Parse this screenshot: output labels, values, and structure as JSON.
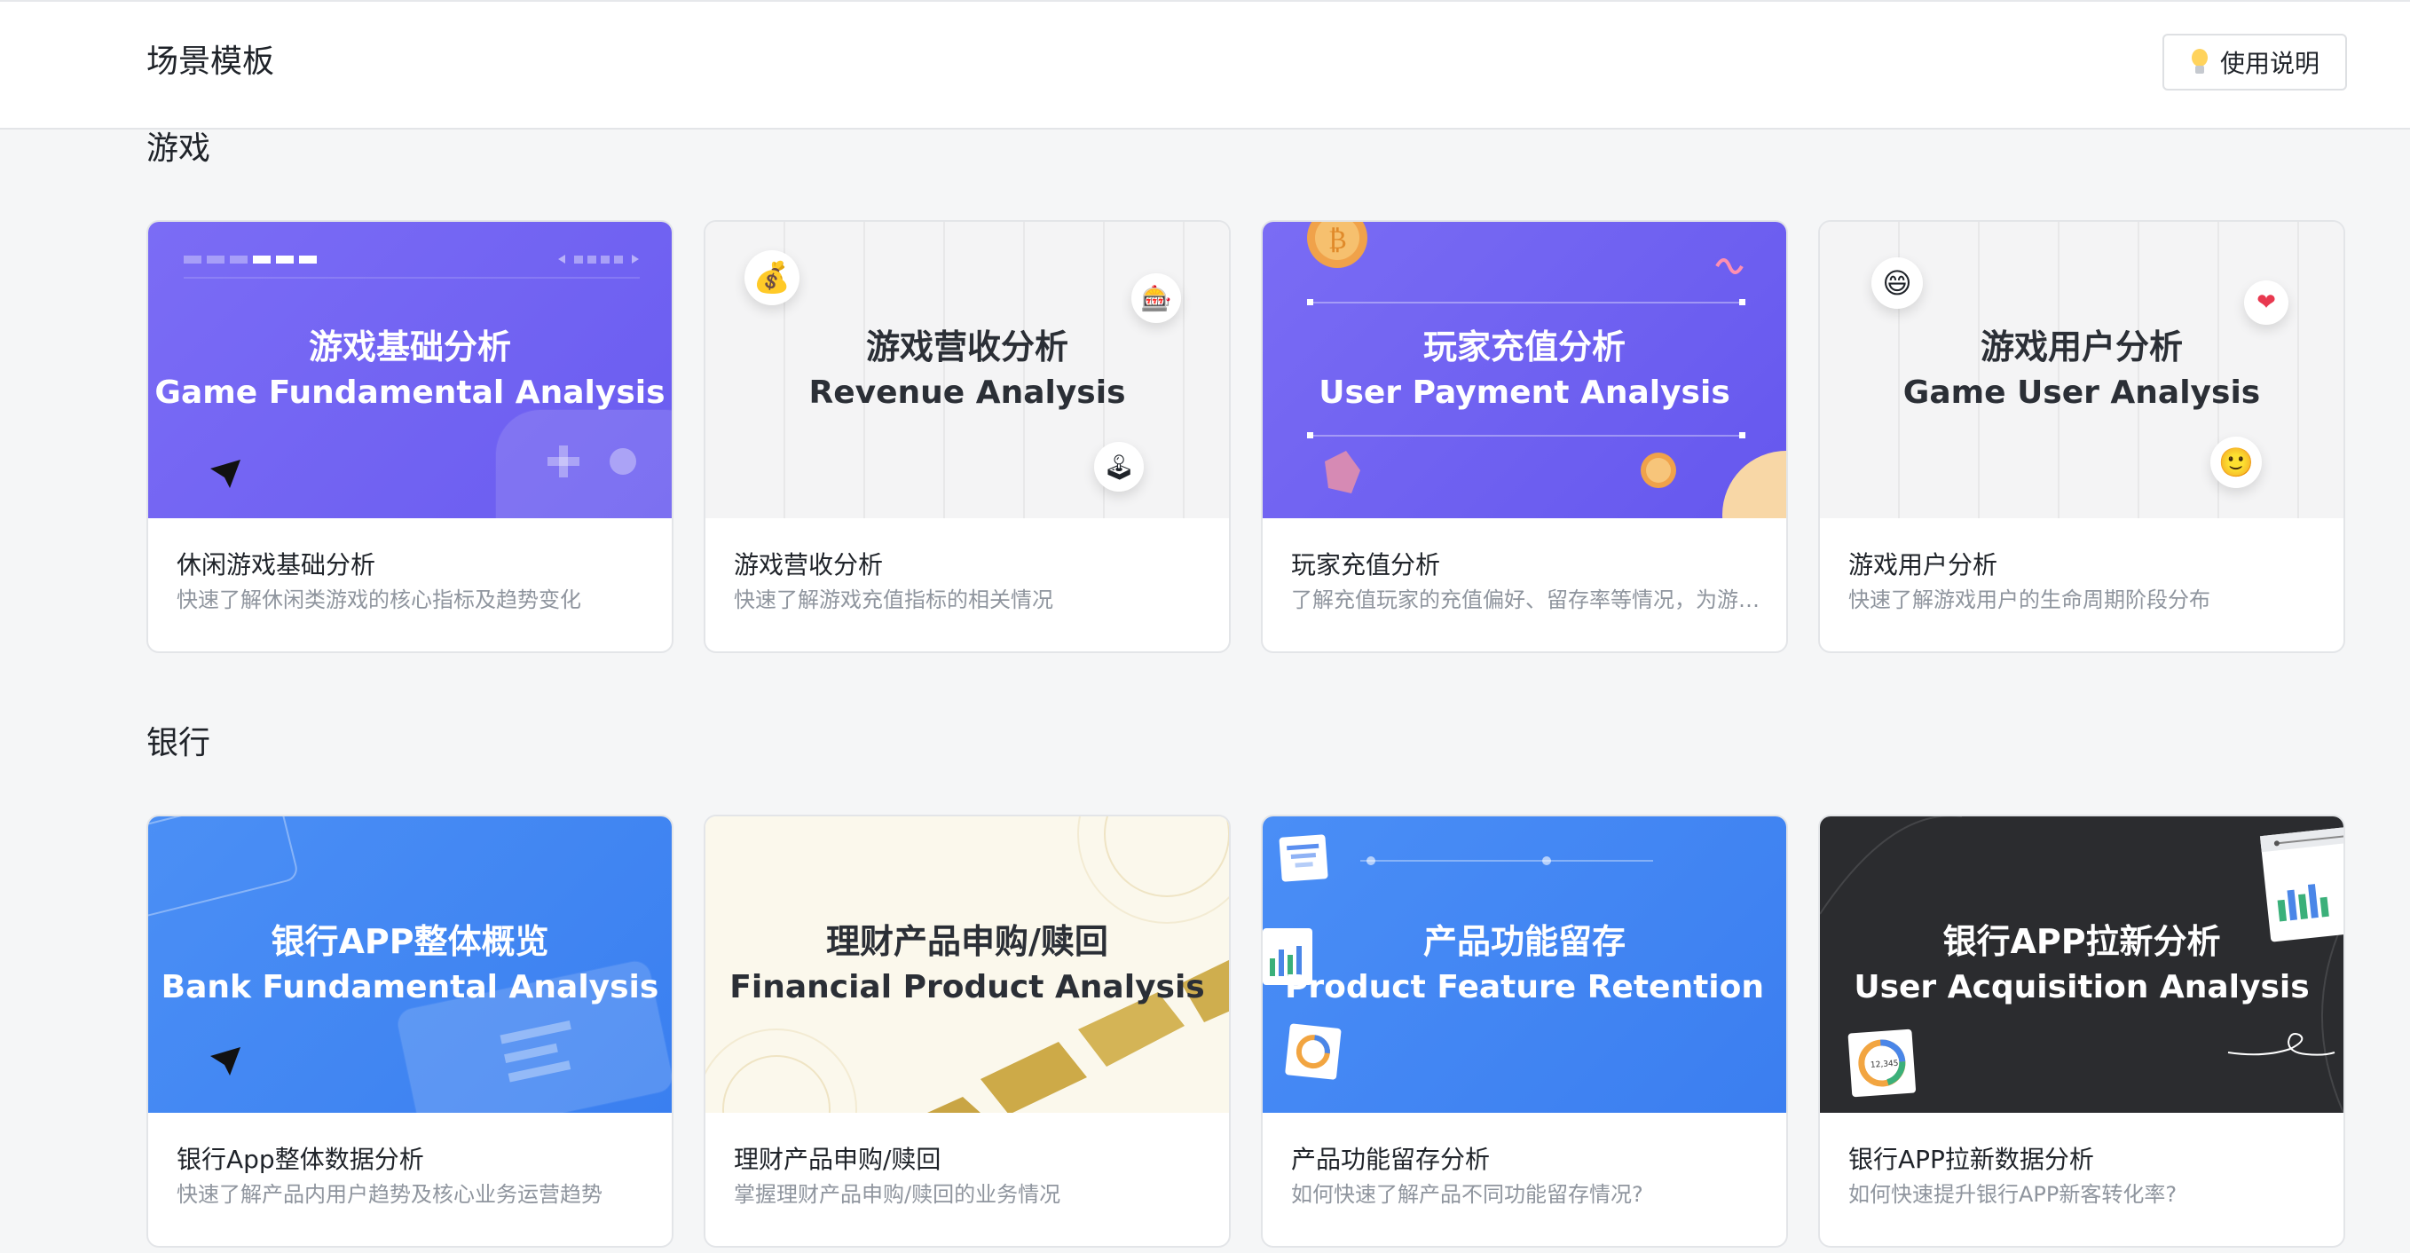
{
  "header": {
    "title": "场景模板",
    "help_label": "使用说明"
  },
  "sections": [
    {
      "title": "游戏",
      "cards": [
        {
          "banner_zh": "游戏基础分析",
          "banner_en": "Game Fundamental Analysis",
          "title": "休闲游戏基础分析",
          "desc": "快速了解休闲类游戏的核心指标及趋势变化"
        },
        {
          "banner_zh": "游戏营收分析",
          "banner_en": "Revenue Analysis",
          "title": "游戏营收分析",
          "desc": "快速了解游戏充值指标的相关情况"
        },
        {
          "banner_zh": "玩家充值分析",
          "banner_en": "User Payment Analysis",
          "title": "玩家充值分析",
          "desc": "了解充值玩家的充值偏好、留存率等情况，为游戏运营提供决策依据"
        },
        {
          "banner_zh": "游戏用户分析",
          "banner_en": "Game User Analysis",
          "title": "游戏用户分析",
          "desc": "快速了解游戏用户的生命周期阶段分布"
        }
      ]
    },
    {
      "title": "银行",
      "cards": [
        {
          "banner_zh": "银行APP整体概览",
          "banner_en": "Bank Fundamental Analysis",
          "title": "银行App整体数据分析",
          "desc": "快速了解产品内用户趋势及核心业务运营趋势"
        },
        {
          "banner_zh": "理财产品申购/赎回",
          "banner_en": "Financial Product Analysis",
          "title": "理财产品申购/赎回",
          "desc": "掌握理财产品申购/赎回的业务情况"
        },
        {
          "banner_zh": "产品功能留存",
          "banner_en": "Product Feature Retention",
          "title": "产品功能留存分析",
          "desc": "如何快速了解产品不同功能留存情况?"
        },
        {
          "banner_zh": "银行APP拉新分析",
          "banner_en": "User Acquisition Analysis",
          "title": "银行APP拉新数据分析",
          "desc": "如何快速提升银行APP新客转化率?"
        }
      ]
    }
  ],
  "icons": {
    "money_bag": "💰",
    "slot_machine": "🎰",
    "joystick": "🕹",
    "grinning_face": "😄",
    "heart": "❤",
    "smiling_face": "🙂",
    "bitcoin_symbol": "₿",
    "navigation_arrow": "➤",
    "donut_chart_label": "12,345"
  },
  "colors": {
    "purple": "#7566f2",
    "gray_card": "#f4f4f5",
    "blue": "#3e83f0",
    "cream": "#fbf8ec",
    "dark": "#2b2c2f"
  }
}
